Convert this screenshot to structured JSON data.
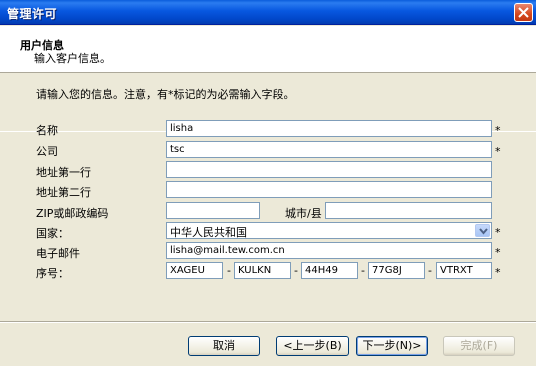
{
  "window": {
    "title": "管理许可"
  },
  "header": {
    "title": "用户信息",
    "subtitle": "输入客户信息。"
  },
  "instructions": "请输入您的信息。注意，有*标记的为必需输入字段。",
  "form": {
    "name_label": "名称",
    "name_value": "lisha",
    "company_label": "公司",
    "company_value": "tsc",
    "addr1_label": "地址第一行",
    "addr1_value": "",
    "addr2_label": "地址第二行",
    "addr2_value": "",
    "zip_label": "ZIP或邮政编码",
    "zip_value": "",
    "city_label": "城市/县",
    "city_value": "",
    "country_label": "国家：",
    "country_value": "中华人民共和国",
    "email_label": "电子邮件",
    "email_value": "lisha@mail.tew.com.cn",
    "serial_label": "序号：",
    "serial_parts": [
      "XAGEU",
      "KULKN",
      "44H49",
      "77G8J",
      "VTRXT"
    ],
    "required_mark": "*",
    "dash": "-"
  },
  "buttons": {
    "cancel": "取消",
    "back": "<上一步(B)",
    "next": "下一步(N)>",
    "finish": "完成(F)"
  },
  "colors": {
    "titlebar": "#0858e0",
    "window_bg": "#ece9d8",
    "field_border": "#7f9db9"
  }
}
